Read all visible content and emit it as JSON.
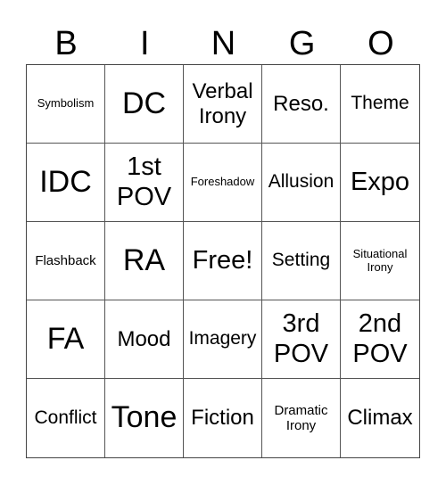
{
  "header": {
    "letters": [
      "B",
      "I",
      "N",
      "G",
      "O"
    ]
  },
  "cells": [
    [
      "Symbolism",
      "DC",
      "Verbal Irony",
      "Reso.",
      "Theme"
    ],
    [
      "IDC",
      "1st POV",
      "Foreshadow",
      "Allusion",
      "Expo"
    ],
    [
      "Flashback",
      "RA",
      "Free!",
      "Setting",
      "Situational Irony"
    ],
    [
      "FA",
      "Mood",
      "Imagery",
      "3rd POV",
      "2nd POV"
    ],
    [
      "Conflict",
      "Tone",
      "Fiction",
      "Dramatic Irony",
      "Climax"
    ]
  ]
}
